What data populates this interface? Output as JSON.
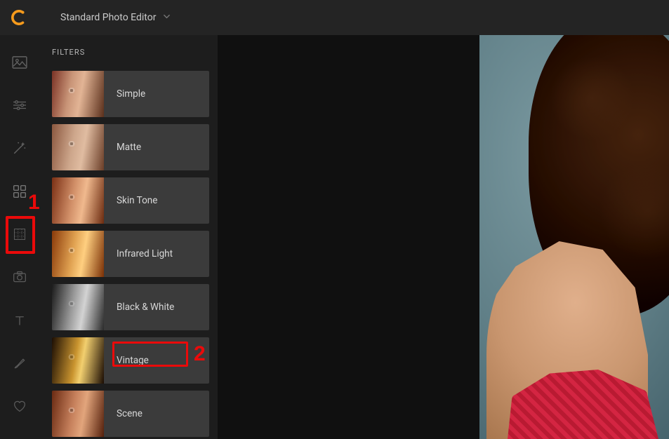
{
  "header": {
    "app_title": "Standard Photo Editor"
  },
  "toolbar": [
    {
      "name": "image-tool-icon"
    },
    {
      "name": "sliders-tool-icon"
    },
    {
      "name": "magic-wand-tool-icon"
    },
    {
      "name": "filters-tool-icon"
    },
    {
      "name": "grid-tool-icon"
    },
    {
      "name": "camera-tool-icon"
    },
    {
      "name": "text-tool-icon"
    },
    {
      "name": "brush-tool-icon"
    },
    {
      "name": "heart-tool-icon"
    }
  ],
  "panel": {
    "title": "FILTERS",
    "filters": [
      {
        "label": "Simple"
      },
      {
        "label": "Matte"
      },
      {
        "label": "Skin Tone"
      },
      {
        "label": "Infrared Light"
      },
      {
        "label": "Black & White"
      },
      {
        "label": "Vintage"
      },
      {
        "label": "Scene"
      }
    ]
  },
  "annotations": {
    "num1": "1",
    "num2": "2"
  }
}
